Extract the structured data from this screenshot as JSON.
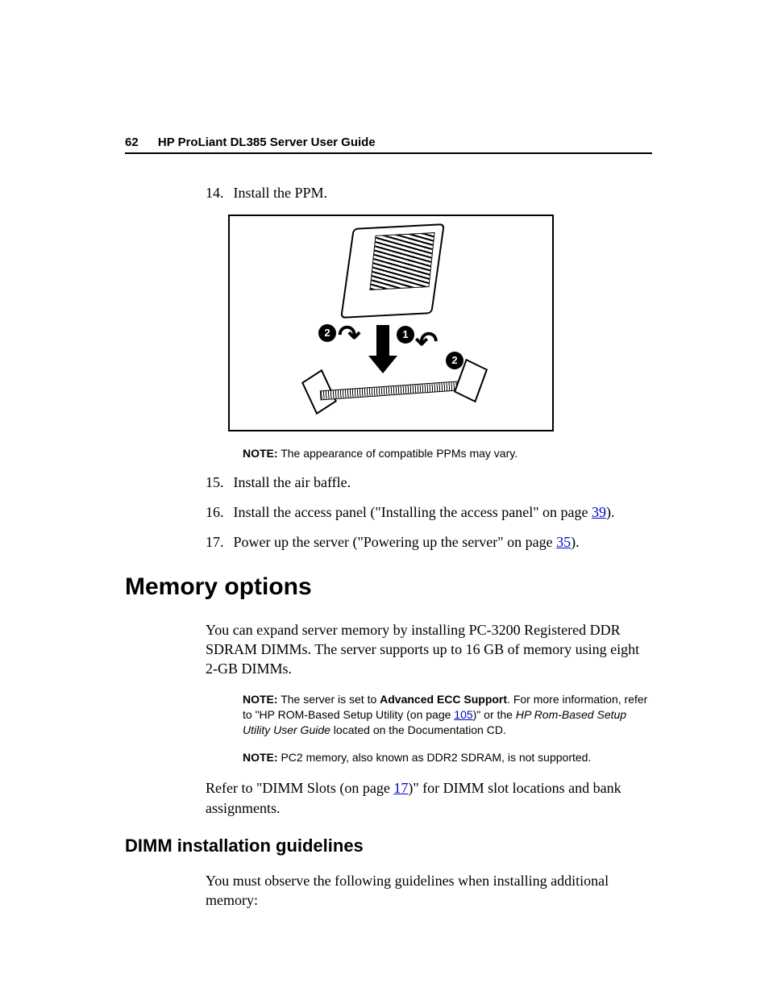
{
  "header": {
    "page_number": "62",
    "title": "HP ProLiant DL385 Server User Guide"
  },
  "steps": {
    "s14": {
      "num": "14.",
      "text": "Install the PPM."
    },
    "s15": {
      "num": "15.",
      "text": "Install the air baffle."
    },
    "s16": {
      "num": "16.",
      "text_before": "Install the access panel (\"Installing the access panel\" on page ",
      "link": "39",
      "text_after": ")."
    },
    "s17": {
      "num": "17.",
      "text_before": "Power up the server (\"Powering up the server\" on page ",
      "link": "35",
      "text_after": ")."
    }
  },
  "figure": {
    "badge1": "1",
    "badge2a": "2",
    "badge2b": "2",
    "note_label": "NOTE:",
    "note_text": "The appearance of compatible PPMs may vary."
  },
  "memory_options": {
    "heading": "Memory options",
    "intro": "You can expand server memory by installing PC-3200 Registered DDR SDRAM DIMMs. The server supports up to 16 GB of memory using eight 2-GB DIMMs.",
    "note1_label": "NOTE:",
    "note1_before": "The server is set to ",
    "note1_bold": "Advanced ECC Support",
    "note1_mid": ". For more information, refer to \"HP ROM-Based Setup Utility (on page ",
    "note1_link": "105",
    "note1_after1": ")\" or the ",
    "note1_italic": "HP Rom-Based Setup Utility User Guide",
    "note1_after2": " located on the Documentation CD.",
    "note2_label": "NOTE:",
    "note2_text": "PC2 memory, also known as DDR2 SDRAM, is not supported.",
    "refer_before": "Refer to \"DIMM Slots (on page ",
    "refer_link": "17",
    "refer_after": ")\" for DIMM slot locations and bank assignments."
  },
  "dimm": {
    "heading": "DIMM installation guidelines",
    "intro": "You must observe the following guidelines when installing additional memory:"
  }
}
